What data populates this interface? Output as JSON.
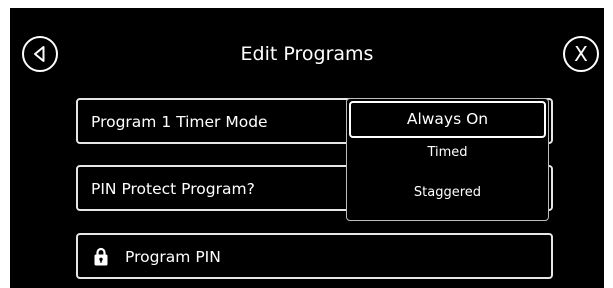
{
  "header": {
    "title": "Edit Programs",
    "close_label": "X",
    "back_icon": "triangle-left-icon"
  },
  "rows": [
    {
      "label": "Program 1 Timer Mode"
    },
    {
      "label": "PIN Protect Program?"
    },
    {
      "label": "Program PIN",
      "icon": "lock-icon"
    }
  ],
  "dropdown": {
    "options": [
      "Always On",
      "Timed",
      "Staggered"
    ],
    "selected": "Always On"
  },
  "colors": {
    "screen_background": "#000000",
    "foreground": "#ffffff",
    "page_background": "#ffffff"
  }
}
